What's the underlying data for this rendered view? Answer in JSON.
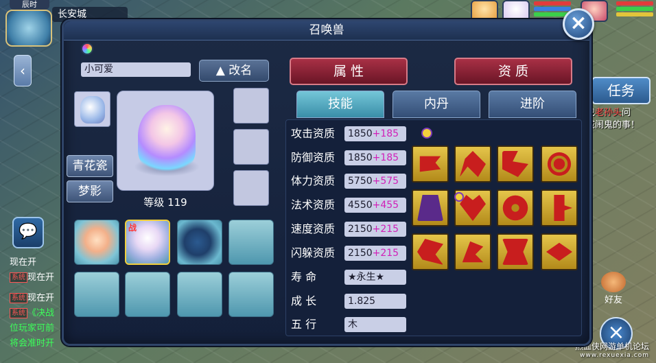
{
  "hud": {
    "time_label": "辰时",
    "city_name": "长安城"
  },
  "chat": {
    "lines": [
      {
        "tag": "",
        "text": "现在开"
      },
      {
        "tag": "系统",
        "text": "现在开"
      },
      {
        "tag": "系统",
        "text": "现在开"
      },
      {
        "tag": "系统",
        "text": "《决战"
      },
      {
        "tag": "",
        "text": "位玩家可前"
      },
      {
        "tag": "",
        "text": "将会准时开"
      }
    ]
  },
  "right_hud": {
    "task_label": "任务",
    "task_text_prefix": "找",
    "task_text_highlight": "老孙头",
    "task_text_mid": "问",
    "task_text_suffix": "城闹鬼的事！",
    "friend_label": "好友"
  },
  "watermark": {
    "line1": "热血侠网游单机论坛",
    "line2": "www.rexuexia.com"
  },
  "panel": {
    "title": "召唤兽",
    "pet_name": "小可爱",
    "rename_label": "▲ 改名",
    "level_label": "等级 119",
    "side_buttons": [
      "青花瓷",
      "梦影"
    ],
    "battle_tag": "战",
    "tabs_main": [
      "属 性",
      "资 质"
    ],
    "tabs_sub": [
      "技能",
      "内丹",
      "进阶"
    ],
    "stats": [
      {
        "label": "攻击资质",
        "base": "1850",
        "bonus": "+185"
      },
      {
        "label": "防御资质",
        "base": "1850",
        "bonus": "+185"
      },
      {
        "label": "体力资质",
        "base": "5750",
        "bonus": "+575"
      },
      {
        "label": "法术资质",
        "base": "4550",
        "bonus": "+455"
      },
      {
        "label": "速度资质",
        "base": "2150",
        "bonus": "+215"
      },
      {
        "label": "闪躲资质",
        "base": "2150",
        "bonus": "+215"
      },
      {
        "label": "寿 命",
        "base": "★永生★",
        "bonus": ""
      },
      {
        "label": "成 长",
        "base": "1.825",
        "bonus": ""
      },
      {
        "label": "五 行",
        "base": "木",
        "bonus": ""
      }
    ],
    "close_icon": "×"
  },
  "colors": {
    "panel_bg": "#14203a",
    "tab_red": "#8a2436",
    "bonus_magenta": "#d11fb8",
    "skill_gold": "#d4b036"
  }
}
